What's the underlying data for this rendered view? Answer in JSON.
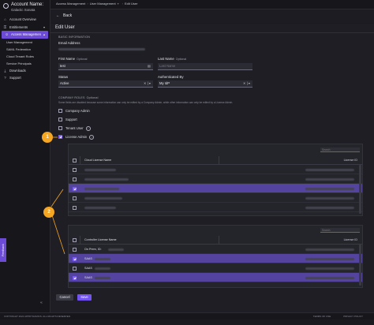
{
  "account": {
    "label": "Account Name:",
    "name": "Galactic Sonata"
  },
  "sidebar": {
    "items": [
      {
        "label": "Account Overview",
        "icon": "home-icon"
      },
      {
        "label": "Entitlements",
        "icon": "key-icon"
      },
      {
        "label": "Access Management",
        "icon": "people-icon",
        "active": true
      }
    ],
    "subitems": [
      "User Management",
      "SAML Federation",
      "Cloud Tenant Roles",
      "Service Principals"
    ],
    "bottom_items": [
      {
        "label": "Downloads",
        "icon": "download-icon"
      },
      {
        "label": "Support",
        "icon": "help-icon"
      }
    ],
    "feedback_label": "Feedback",
    "collapse_glyph": "«"
  },
  "header": {
    "breadcrumbs": [
      "Access Management",
      "User Management",
      "Edit User"
    ],
    "back_label": "Back",
    "page_title": "Edit User"
  },
  "basic": {
    "section_title": "BASIC INFORMATION",
    "email_label": "Email Address",
    "first_name_label": "First Name",
    "first_name_value": "test",
    "last_name_label": "Last Name",
    "last_name_placeholder": "Last Name",
    "optional": "Optional",
    "status_label": "Status",
    "status_value": "Active",
    "auth_label": "Authenticated By",
    "auth_value": "My IdP"
  },
  "roles": {
    "section_title": "COMPANY ROLES",
    "optional": "Optional",
    "note": "Some fields are disabled because some information can only be edited by a Company Admin, while other information can only be edited by a License Admin.",
    "items": [
      {
        "label": "Company Admin",
        "checked": false
      },
      {
        "label": "Support",
        "checked": false
      },
      {
        "label": "Tenant User",
        "checked": false,
        "info": true
      },
      {
        "label": "License Admin",
        "checked": true,
        "info": true
      }
    ]
  },
  "cloud_table": {
    "search_placeholder": "Search",
    "col_name": "Cloud License Name",
    "col_id": "License ID",
    "rows": [
      {
        "selected": false,
        "name_w": 40
      },
      {
        "selected": false,
        "name_w": 56
      },
      {
        "selected": true,
        "name_w": 44
      },
      {
        "selected": false,
        "name_w": 48
      },
      {
        "selected": false,
        "name_w": 40
      }
    ]
  },
  "controller_table": {
    "search_placeholder": "Search",
    "col_name": "Controller License Name",
    "col_id": "License ID",
    "rows": [
      {
        "selected": false,
        "name": "On Prem, ID:"
      },
      {
        "selected": true,
        "name": "SAAS"
      },
      {
        "selected": false,
        "name": "SAAS"
      },
      {
        "selected": true,
        "name": "SAAS"
      }
    ]
  },
  "actions": {
    "cancel_label": "Cancel",
    "save_label": "Save"
  },
  "callouts": [
    "1",
    "2"
  ],
  "footer": {
    "copyright": "COPYRIGHT 2022 APPDYNAMICS. ALL RIGHTS RESERVED.",
    "terms": "TERMS OF USE",
    "privacy": "PRIVACY POLICY"
  },
  "colors": {
    "accent": "#6c4bd6",
    "selected_row": "#55449f",
    "callout": "#f5a623"
  }
}
